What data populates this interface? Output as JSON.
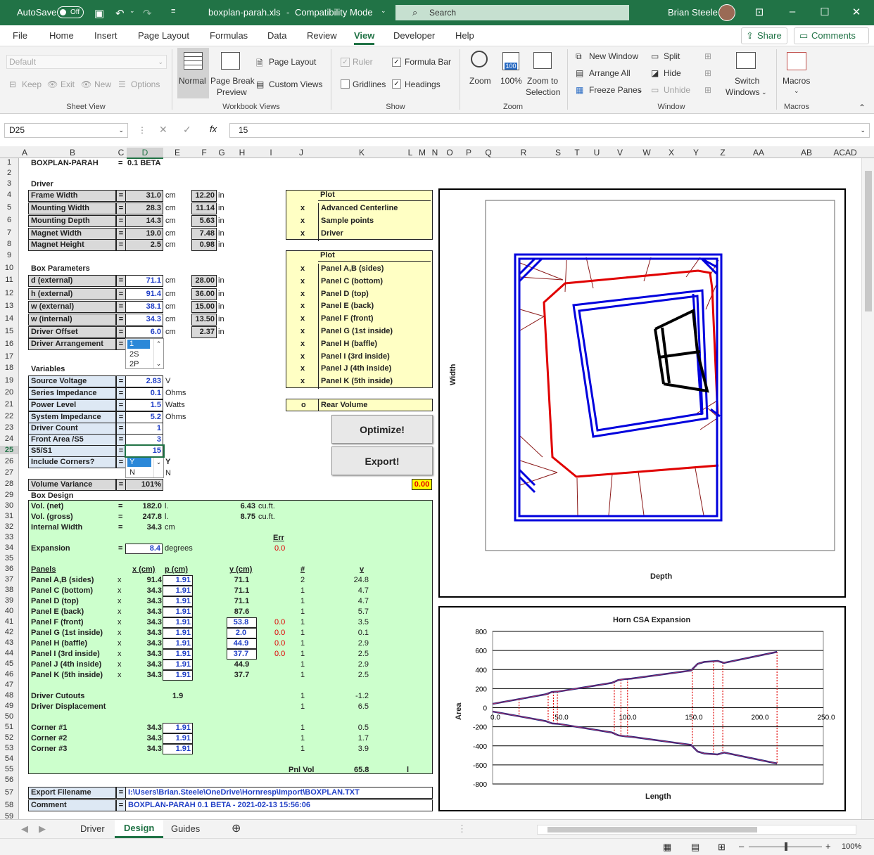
{
  "titlebar": {
    "autosave": "AutoSave",
    "autosave_state": "Off",
    "filename": "boxplan-parah.xls",
    "mode": "Compatibility Mode",
    "search": "Search",
    "user": "Brian Steele"
  },
  "menu": {
    "tabs": [
      "File",
      "Home",
      "Insert",
      "Page Layout",
      "Formulas",
      "Data",
      "Review",
      "View",
      "Developer",
      "Help"
    ],
    "active": "View",
    "share": "Share",
    "comments": "Comments"
  },
  "ribbon": {
    "sheet_view": {
      "dropdown": "Default",
      "keep": "Keep",
      "exit": "Exit",
      "new": "New",
      "options": "Options",
      "group": "Sheet View"
    },
    "workbook_views": {
      "normal": "Normal",
      "page_break_1": "Page Break",
      "page_break_2": "Preview",
      "page_layout": "Page Layout",
      "custom_views": "Custom Views",
      "group": "Workbook Views"
    },
    "show": {
      "ruler": "Ruler",
      "formula_bar": "Formula Bar",
      "gridlines": "Gridlines",
      "headings": "Headings",
      "group": "Show"
    },
    "zoom": {
      "zoom": "Zoom",
      "hundred": "100%",
      "hundred_icon": "100",
      "zoom_sel_1": "Zoom to",
      "zoom_sel_2": "Selection",
      "group": "Zoom"
    },
    "window": {
      "new_window": "New Window",
      "arrange_all": "Arrange All",
      "freeze_panes": "Freeze Panes",
      "split": "Split",
      "hide": "Hide",
      "unhide": "Unhide",
      "switch_1": "Switch",
      "switch_2": "Windows",
      "group": "Window"
    },
    "macros": {
      "macros": "Macros",
      "group": "Macros"
    }
  },
  "formula_bar": {
    "name_box": "D25",
    "formula": "15"
  },
  "columns": [
    "A",
    "B",
    "C",
    "D",
    "E",
    "F",
    "G",
    "H",
    "I",
    "J",
    "K",
    "L",
    "M",
    "N",
    "O",
    "P",
    "Q",
    "R",
    "S",
    "T",
    "U",
    "V",
    "W",
    "X",
    "Y",
    "Z",
    "AA",
    "AB",
    "ACAD"
  ],
  "sheet": {
    "title": "BOXPLAN-PARAH",
    "title_eq": "=",
    "version": "0.1 BETA",
    "driver_header": "Driver",
    "driver_rows": [
      {
        "label": "Frame Width",
        "eq": "=",
        "value": "31.0",
        "unit": "cm",
        "value2": "12.20",
        "unit2": "in"
      },
      {
        "label": "Mounting Width",
        "eq": "=",
        "value": "28.3",
        "unit": "cm",
        "value2": "11.14",
        "unit2": "in"
      },
      {
        "label": "Mounting Depth",
        "eq": "=",
        "value": "14.3",
        "unit": "cm",
        "value2": "5.63",
        "unit2": "in"
      },
      {
        "label": "Magnet Width",
        "eq": "=",
        "value": "19.0",
        "unit": "cm",
        "value2": "7.48",
        "unit2": "in"
      },
      {
        "label": "Magnet Height",
        "eq": "=",
        "value": "2.5",
        "unit": "cm",
        "value2": "0.98",
        "unit2": "in"
      }
    ],
    "box_header": "Box Parameters",
    "box_rows": [
      {
        "label": "d (external)",
        "eq": "=",
        "value": "71.1",
        "unit": "cm",
        "value2": "28.00",
        "unit2": "in"
      },
      {
        "label": "h (external)",
        "eq": "=",
        "value": "91.4",
        "unit": "cm",
        "value2": "36.00",
        "unit2": "in"
      },
      {
        "label": "w (external)",
        "eq": "=",
        "value": "38.1",
        "unit": "cm",
        "value2": "15.00",
        "unit2": "in"
      },
      {
        "label": "w (internal)",
        "eq": "=",
        "value": "34.3",
        "unit": "cm",
        "value2": "13.50",
        "unit2": "in"
      },
      {
        "label": "Driver Offset",
        "eq": "=",
        "value": "6.0",
        "unit": "cm",
        "value2": "2.37",
        "unit2": "in"
      }
    ],
    "driver_arrangement": {
      "label": "Driver Arrangement",
      "eq": "=",
      "options": [
        "1",
        "2S",
        "2P"
      ]
    },
    "variables_header": "Variables",
    "var_rows": [
      {
        "label": "Source Voltage",
        "eq": "=",
        "value": "2.83",
        "unit": "V"
      },
      {
        "label": "Series Impedance",
        "eq": "=",
        "value": "0.1",
        "unit": "Ohms"
      },
      {
        "label": "Power Level",
        "eq": "=",
        "value": "1.5",
        "unit": "Watts"
      },
      {
        "label": "System Impedance",
        "eq": "=",
        "value": "5.2",
        "unit": "Ohms"
      },
      {
        "label": "Driver Count",
        "eq": "=",
        "value": "1",
        "unit": ""
      },
      {
        "label": "Front Area /S5",
        "eq": "=",
        "value": "3",
        "unit": ""
      },
      {
        "label": "S5/S1",
        "eq": "=",
        "value": "15",
        "unit": ""
      }
    ],
    "include_corners": {
      "label": "Include Corners?",
      "eq": "=",
      "options": [
        "Y",
        "N"
      ],
      "col_y": "Y",
      "col_n": "N"
    },
    "volume_variance": {
      "label": "Volume Variance",
      "eq": "=",
      "value": "101%",
      "variance_value": "0.00"
    },
    "box_design": {
      "header": "Box Design",
      "vol_net": {
        "label": "Vol. (net)",
        "eq": "=",
        "value": "182.0",
        "unit": "l.",
        "cuft": "6.43",
        "cuft_unit": "cu.ft."
      },
      "vol_gross": {
        "label": "Vol. (gross)",
        "eq": "=",
        "value": "247.8",
        "unit": "l.",
        "cuft": "8.75",
        "cuft_unit": "cu.ft."
      },
      "internal_width": {
        "label": "Internal Width",
        "eq": "=",
        "value": "34.3",
        "unit": "cm"
      },
      "err_header": "Err",
      "expansion": {
        "label": "Expansion",
        "eq": "=",
        "value": "8.4",
        "unit": "degrees",
        "err": "0.0"
      }
    },
    "panels_header": {
      "panels": "Panels",
      "x": "x (cm)",
      "p": "p (cm)",
      "y": "y (cm)",
      "n": "#",
      "v": "v"
    },
    "panels": [
      {
        "name": "Panel A,B (sides)",
        "x": "x",
        "xcm": "91.4",
        "p": "1.91",
        "y": "71.1",
        "y_input": false,
        "err": "",
        "n": "2",
        "v": "24.8"
      },
      {
        "name": "Panel C (bottom)",
        "x": "x",
        "xcm": "34.3",
        "p": "1.91",
        "y": "71.1",
        "y_input": false,
        "err": "",
        "n": "1",
        "v": "4.7"
      },
      {
        "name": "Panel D (top)",
        "x": "x",
        "xcm": "34.3",
        "p": "1.91",
        "y": "71.1",
        "y_input": false,
        "err": "",
        "n": "1",
        "v": "4.7"
      },
      {
        "name": "Panel E (back)",
        "x": "x",
        "xcm": "34.3",
        "p": "1.91",
        "y": "87.6",
        "y_input": false,
        "err": "",
        "n": "1",
        "v": "5.7"
      },
      {
        "name": "Panel F (front)",
        "x": "x",
        "xcm": "34.3",
        "p": "1.91",
        "y": "53.8",
        "y_input": true,
        "err": "0.0",
        "n": "1",
        "v": "3.5"
      },
      {
        "name": "Panel G (1st inside)",
        "x": "x",
        "xcm": "34.3",
        "p": "1.91",
        "y": "2.0",
        "y_input": true,
        "err": "0.0",
        "n": "1",
        "v": "0.1"
      },
      {
        "name": "Panel H (baffle)",
        "x": "x",
        "xcm": "34.3",
        "p": "1.91",
        "y": "44.9",
        "y_input": true,
        "err": "0.0",
        "n": "1",
        "v": "2.9"
      },
      {
        "name": "Panel I (3rd inside)",
        "x": "x",
        "xcm": "34.3",
        "p": "1.91",
        "y": "37.7",
        "y_input": true,
        "err": "0.0",
        "n": "1",
        "v": "2.5"
      },
      {
        "name": "Panel J (4th inside)",
        "x": "x",
        "xcm": "34.3",
        "p": "1.91",
        "y": "44.9",
        "y_input": false,
        "err": "",
        "n": "1",
        "v": "2.9"
      },
      {
        "name": "Panel K (5th inside)",
        "x": "x",
        "xcm": "34.3",
        "p": "1.91",
        "y": "37.7",
        "y_input": false,
        "err": "",
        "n": "1",
        "v": "2.5"
      }
    ],
    "driver_cutouts": {
      "label": "Driver Cutouts",
      "value": "1.9",
      "n": "1",
      "v": "-1.2"
    },
    "driver_displacement": {
      "label": "Driver Displacement",
      "n": "1",
      "v": "6.5"
    },
    "corners": [
      {
        "name": "Corner #1",
        "xcm": "34.3",
        "p": "1.91",
        "n": "1",
        "v": "0.5"
      },
      {
        "name": "Corner #2",
        "xcm": "34.3",
        "p": "1.91",
        "n": "1",
        "v": "1.7"
      },
      {
        "name": "Corner #3",
        "xcm": "34.3",
        "p": "1.91",
        "n": "1",
        "v": "3.9"
      }
    ],
    "pnl_vol": {
      "label": "Pnl Vol",
      "value": "65.8",
      "unit": "l"
    },
    "export_filename": {
      "label": "Export Filename",
      "eq": "=",
      "value": "I:\\Users\\Brian.Steele\\OneDrive\\Hornresp\\Import\\BOXPLAN.TXT"
    },
    "comment": {
      "label": "Comment",
      "eq": "=",
      "value": "BOXPLAN-PARAH 0.1 BETA - 2021-02-13 15:56:06"
    },
    "plot1": {
      "header": "Plot",
      "items": [
        {
          "mark": "x",
          "label": "Advanced Centerline"
        },
        {
          "mark": "x",
          "label": "Sample points"
        },
        {
          "mark": "x",
          "label": "Driver"
        }
      ]
    },
    "plot2": {
      "header": "Plot",
      "items": [
        {
          "mark": "x",
          "label": "Panel A,B (sides)"
        },
        {
          "mark": "x",
          "label": "Panel C (bottom)"
        },
        {
          "mark": "x",
          "label": "Panel D (top)"
        },
        {
          "mark": "x",
          "label": "Panel E (back)"
        },
        {
          "mark": "x",
          "label": "Panel F (front)"
        },
        {
          "mark": "x",
          "label": "Panel G (1st inside)"
        },
        {
          "mark": "x",
          "label": "Panel H (baffle)"
        },
        {
          "mark": "x",
          "label": "Panel I (3rd inside)"
        },
        {
          "mark": "x",
          "label": "Panel J (4th inside)"
        },
        {
          "mark": "x",
          "label": "Panel K (5th inside)"
        }
      ]
    },
    "rear_volume": {
      "mark": "o",
      "label": "Rear Volume"
    },
    "optimize_label": "Optimize!",
    "export_label": "Export!"
  },
  "chart_data": [
    {
      "type": "diagram",
      "xlabel": "Depth",
      "ylabel": "Width"
    },
    {
      "type": "line",
      "title": "Horn CSA Expansion",
      "xlabel": "Length",
      "ylabel": "Area",
      "xlim": [
        0,
        250
      ],
      "ylim": [
        -800,
        800
      ],
      "xticks": [
        "0.0",
        "50.0",
        "100.0",
        "150.0",
        "200.0",
        "250.0"
      ],
      "yticks": [
        "800",
        "600",
        "400",
        "200",
        "0",
        "-200",
        "-400",
        "-600",
        "-800"
      ],
      "series": [
        {
          "values_x": [
            0,
            20,
            40,
            45,
            50,
            90,
            95,
            100,
            105,
            150,
            155,
            160,
            170,
            175,
            215
          ],
          "values_y": [
            40,
            90,
            140,
            165,
            170,
            260,
            290,
            300,
            305,
            390,
            460,
            480,
            490,
            470,
            585
          ]
        },
        {
          "values_x": [
            0,
            20,
            40,
            45,
            50,
            90,
            95,
            100,
            105,
            150,
            155,
            160,
            170,
            175,
            215
          ],
          "values_y": [
            -40,
            -90,
            -140,
            -165,
            -170,
            -260,
            -290,
            -300,
            -305,
            -390,
            -460,
            -480,
            -490,
            -470,
            -585
          ]
        }
      ],
      "sample_x": [
        20,
        42,
        46,
        49,
        92,
        97,
        102,
        151,
        167,
        174,
        215
      ]
    }
  ],
  "sheet_tabs": {
    "tabs": [
      "Driver",
      "Design",
      "Guides"
    ],
    "active": "Design"
  },
  "status": {
    "zoom": "100%"
  }
}
